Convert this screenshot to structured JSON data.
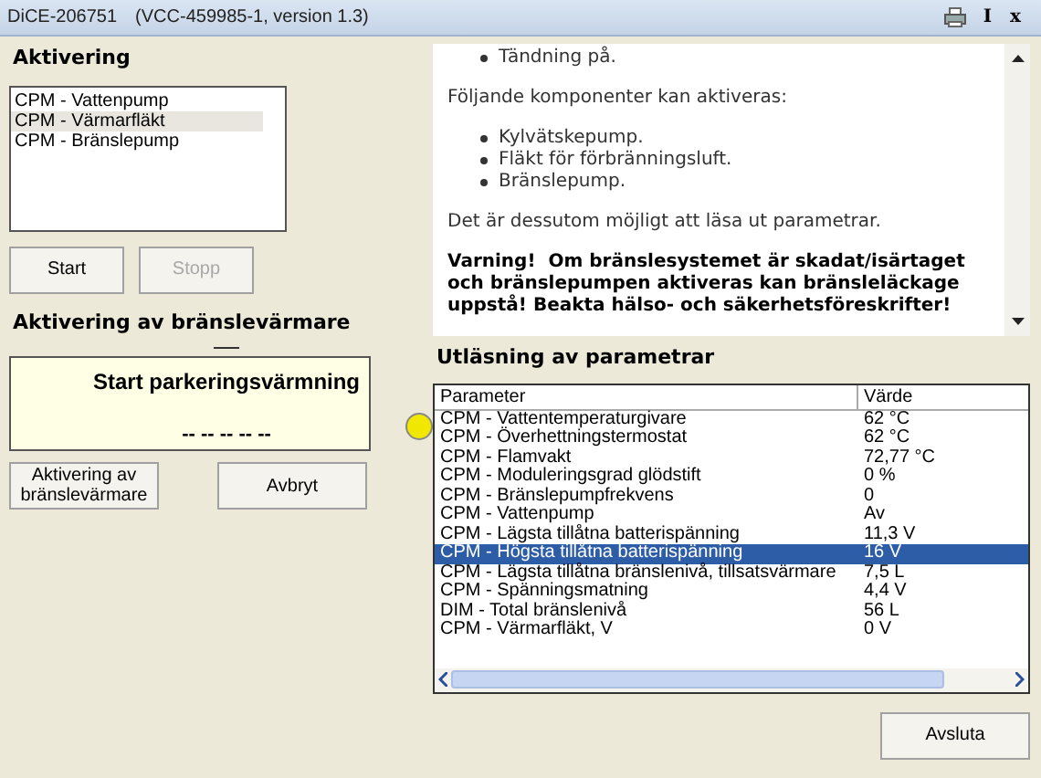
{
  "window": {
    "title": "DiCE-206751",
    "subtitle": "(VCC-459985-1, version 1.3)",
    "title_buttons": [
      "I",
      "x"
    ]
  },
  "activation": {
    "heading": "Aktivering",
    "items": [
      {
        "label": "CPM - Vattenpump",
        "selected": false
      },
      {
        "label": "CPM - Värmarfläkt",
        "selected": true
      },
      {
        "label": "CPM - Bränslepump",
        "selected": false
      }
    ],
    "buttons": [
      {
        "label": "Start",
        "disabled": false
      },
      {
        "label": "Stopp",
        "disabled": true
      }
    ]
  },
  "heater": {
    "heading": "Aktivering av bränslevärmare",
    "status_title": "Start parkeringsvärmning",
    "status_value": "-- -- -- -- --",
    "buttons": [
      {
        "label": "Aktivering av bränslevärmare"
      },
      {
        "label": "Avbryt"
      }
    ]
  },
  "info": {
    "top_bullets": [
      "Tändning på."
    ],
    "intro": "Följande komponenter kan aktiveras:",
    "bullets": [
      "Kylvätskepump.",
      "Fläkt för förbränningsluft.",
      "Bränslepump."
    ],
    "note": "Det är dessutom möjligt att läsa ut parametrar.",
    "warning": "Varning!  Om bränslesystemet är skadat/isärtaget och bränslepumpen aktiveras kan bränsleläckage uppstå! Beakta hälso- och säkerhetsföreskrifter!"
  },
  "readout": {
    "heading": "Utläsning av parametrar",
    "columns": [
      "Parameter",
      "Värde"
    ],
    "rows": [
      {
        "parameter": "CPM - Vattentemperaturgivare",
        "value": "62 °C",
        "selected": false
      },
      {
        "parameter": "CPM - Överhettningstermostat",
        "value": "62 °C",
        "selected": false
      },
      {
        "parameter": "CPM - Flamvakt",
        "value": "72,77 °C",
        "selected": false
      },
      {
        "parameter": "CPM - Moduleringsgrad glödstift",
        "value": "0 %",
        "selected": false
      },
      {
        "parameter": "CPM - Bränslepumpfrekvens",
        "value": "0",
        "selected": false
      },
      {
        "parameter": "CPM - Vattenpump",
        "value": "Av",
        "selected": false
      },
      {
        "parameter": "CPM - Lägsta tillåtna batterispänning",
        "value": "11,3 V",
        "selected": false
      },
      {
        "parameter": "CPM - Högsta tillåtna batterispänning",
        "value": "16 V",
        "selected": true
      },
      {
        "parameter": "CPM - Lägsta tillåtna bränslenivå, tillsatsvärmare",
        "value": "7,5 L",
        "selected": false
      },
      {
        "parameter": "CPM - Spänningsmatning",
        "value": "4,4 V",
        "selected": false
      },
      {
        "parameter": "DIM - Total bränslenivå",
        "value": "56 L",
        "selected": false
      },
      {
        "parameter": "CPM - Värmarfläkt, V",
        "value": "0 V",
        "selected": false
      }
    ]
  },
  "footer": {
    "close_button": "Avsluta"
  }
}
